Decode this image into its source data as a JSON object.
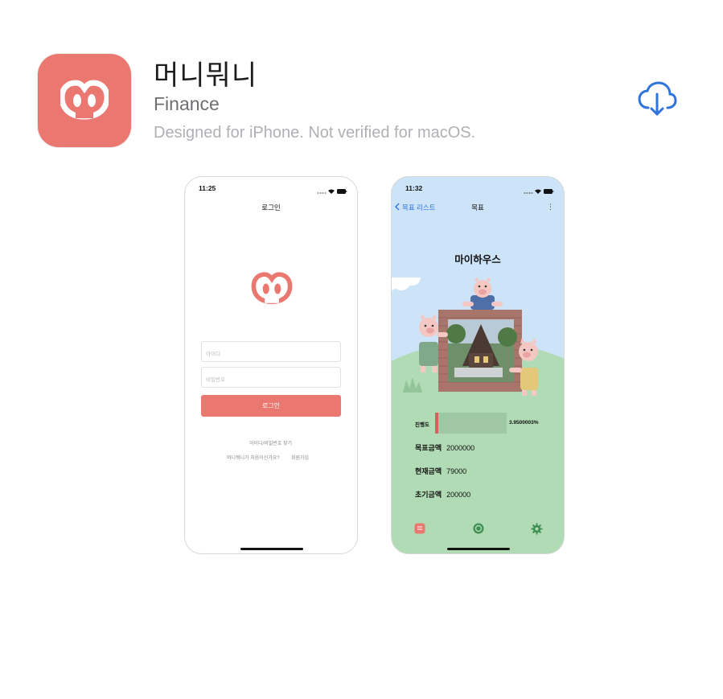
{
  "app": {
    "name": "머니뭐니",
    "category": "Finance",
    "note": "Designed for iPhone. Not verified for macOS.",
    "brand_color": "#eb7870",
    "download_icon": "icloud-download-icon"
  },
  "screenshot1": {
    "time": "11:25",
    "title": "로그인",
    "id_placeholder": "아이디",
    "password_placeholder": "비밀번호",
    "login_button": "로그인",
    "find_link": "아이디/비밀번호 찾기",
    "first_time_link": "머니뭐니가 처음이신가요?",
    "signup_link": "회원가입"
  },
  "screenshot2": {
    "time": "11:32",
    "back_label": "목표 리스트",
    "title": "목표",
    "goal_name": "마이하우스",
    "progress_label": "진행도",
    "progress_value": "3.9500003%",
    "progress_fraction": 0.0395,
    "rows": [
      {
        "key": "목표금액",
        "value": "2000000"
      },
      {
        "key": "현재금액",
        "value": "79000"
      },
      {
        "key": "초기금액",
        "value": "200000"
      }
    ],
    "tab_icons": [
      "list-tab-icon",
      "coin-tab-icon",
      "settings-tab-icon"
    ]
  }
}
